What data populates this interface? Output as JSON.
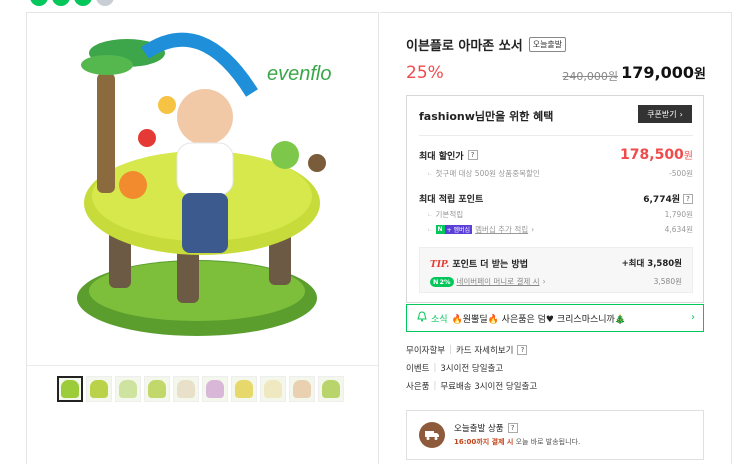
{
  "product": {
    "title": "이븐플로 아마존 쏘서",
    "today_badge": "오늘출발",
    "discount": "25%",
    "original_price": "240,000원",
    "sale_price": "179,000",
    "sale_currency": "원",
    "brand_logo": "evenflo"
  },
  "benefit": {
    "header": "fashionw님만을 위한 혜택",
    "coupon_button": "쿠폰받기",
    "max_discount_label": "최대 할인가",
    "max_discount_price": "178,500",
    "max_discount_currency": "원",
    "first_purchase_label": "첫구매 대상 500원 상품중복할인",
    "first_purchase_amount": "-500원",
    "max_points_label": "최대 적립 포인트",
    "max_points_value": "6,774원",
    "basic_label": "기본적립",
    "basic_value": "1,790원",
    "npay_n": "N",
    "npay_plus": "+ 멤버십",
    "membership_label": "멤버십 추가 적립",
    "membership_value": "4,634원",
    "tip_word": "TIP.",
    "tip_title": "포인트 더 받는 방법",
    "tip_max": "+최대 3,580원",
    "tip_pct": "2%",
    "tip_sub": "네이버페이 머니로 결제 시",
    "tip_amount": "3,580원"
  },
  "news": {
    "label": "소식",
    "text": "🔥원뿔딜🔥 사은품은 덤♥ 크리스마스니까🎄"
  },
  "info": {
    "installment_label": "무이자할부",
    "installment_value": "카드 자세히보기",
    "event_label": "이벤트",
    "event_value": "3시이전 당일출고",
    "gift_label": "사은품",
    "gift_value": "무료배송 3시이전 당일출고"
  },
  "today_ship": {
    "title": "오늘출발 상품",
    "desc_highlight": "16:00까지 결제 시",
    "desc_rest": "오늘 바로 발송됩니다."
  },
  "colors": {
    "accent_green": "#03c75a",
    "price_red": "#f04b4b"
  }
}
